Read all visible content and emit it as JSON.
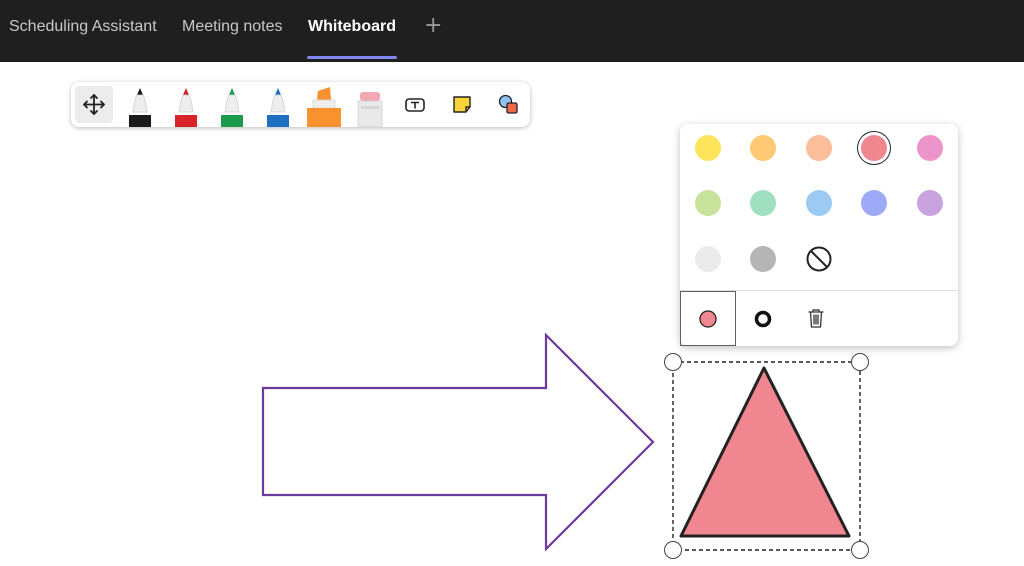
{
  "tabs": [
    {
      "label": "Scheduling Assistant",
      "active": false
    },
    {
      "label": "Meeting notes",
      "active": false
    },
    {
      "label": "Whiteboard",
      "active": true
    }
  ],
  "add_tab_symbol": "+",
  "toolbar": {
    "tools": [
      {
        "name": "move-tool",
        "icon": "move-arrows-icon",
        "selected": true
      },
      {
        "name": "black-pen",
        "color": "#1a1a1a"
      },
      {
        "name": "red-pen",
        "color": "#d8232a"
      },
      {
        "name": "green-pen",
        "color": "#1b9a4a"
      },
      {
        "name": "blue-pen",
        "color": "#1f6fc1"
      },
      {
        "name": "highlighter",
        "color": "#f7922f"
      },
      {
        "name": "eraser",
        "color": "#f1a8b4"
      },
      {
        "name": "text-tool",
        "icon": "text-box-icon"
      },
      {
        "name": "sticky-note",
        "icon": "sticky-note-icon",
        "color": "#f9d33a"
      },
      {
        "name": "shapes",
        "icon": "shapes-icon",
        "colors": [
          "#8fc4f0",
          "#f0674a"
        ]
      }
    ]
  },
  "color_picker": {
    "colors": [
      "#fce45a",
      "#fdc975",
      "#fbbd9a",
      "#f0868f",
      "#ed95ca",
      "#c8e39c",
      "#9ee0bf",
      "#9bcaf3",
      "#9eaaf8",
      "#c9a3e0",
      "#ebebeb",
      "#b5b5b5",
      "none"
    ],
    "selected_color": "#f0868f",
    "actions": [
      {
        "name": "fill-color",
        "icon": "fill-dot-icon",
        "selected": true
      },
      {
        "name": "stroke-color",
        "icon": "stroke-ring-icon",
        "selected": false
      },
      {
        "name": "delete",
        "icon": "trash-icon",
        "selected": false
      }
    ]
  },
  "canvas": {
    "arrow": {
      "stroke": "#6a3b9c",
      "fill": "#ffffff"
    },
    "triangle": {
      "fill": "#f0868f",
      "stroke": "#222222",
      "selected": true
    }
  }
}
